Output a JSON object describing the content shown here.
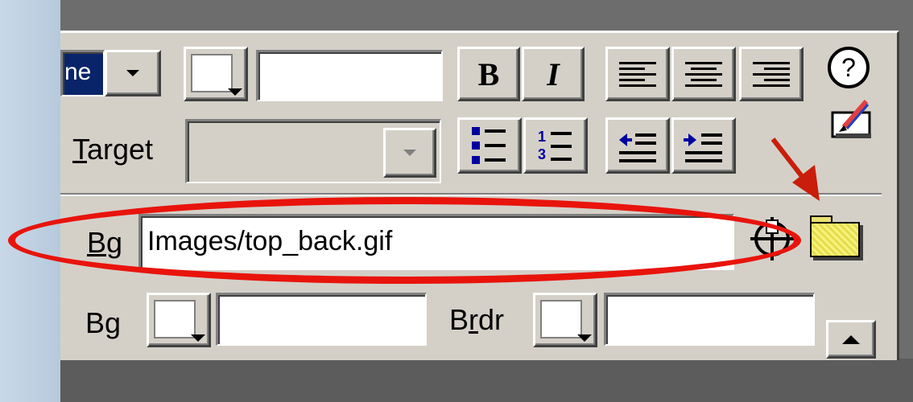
{
  "toolbar": {
    "format_partial": "ne",
    "bold_label": "B",
    "italic_label": "I",
    "link_value": "",
    "target_label_prefix": "T",
    "target_label_rest": "arget"
  },
  "row_bg_image": {
    "label_underlined": "B",
    "label_rest": "g",
    "value": "Images/top_back.gif"
  },
  "row_colors": {
    "bg_label": "Bg",
    "bg_value": "",
    "brdr_label_pre": "B",
    "brdr_label_ul": "r",
    "brdr_label_post": "dr",
    "brdr_value": ""
  },
  "icons": [
    "help-icon",
    "edit-tag-icon",
    "point-to-file-icon",
    "browse-folder-icon",
    "expand-arrow-icon",
    "unordered-list-icon",
    "ordered-list-icon",
    "outdent-icon",
    "indent-icon",
    "align-left-icon",
    "align-center-icon",
    "align-right-icon"
  ],
  "colors": {
    "annotation_red": "#e8140c",
    "arrow_red": "#c81e0a",
    "panel_grey": "#d4d0c8",
    "format_highlight": "#0a246a"
  }
}
